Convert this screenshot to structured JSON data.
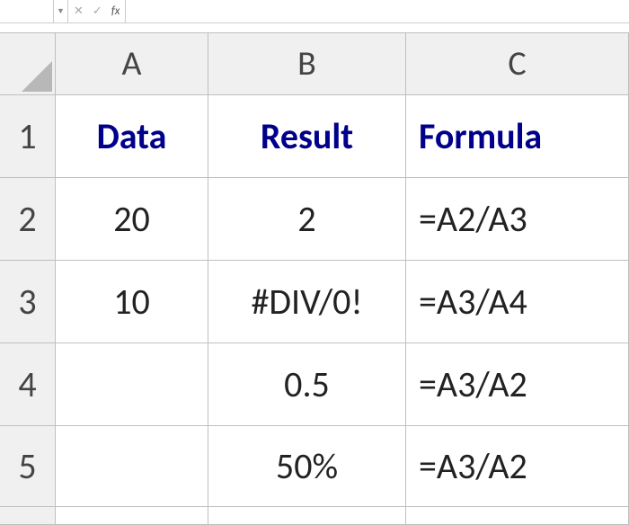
{
  "formula_bar": {
    "namebox": "",
    "cancel_label": "✕",
    "enter_label": "✓",
    "fx_label": "fx",
    "input": ""
  },
  "columns": [
    "A",
    "B",
    "C"
  ],
  "rows": [
    "1",
    "2",
    "3",
    "4",
    "5"
  ],
  "grid": {
    "r1": {
      "a": "Data",
      "b": "Result",
      "c": "Formula"
    },
    "r2": {
      "a": "20",
      "b": "2",
      "c": "=A2/A3"
    },
    "r3": {
      "a": "10",
      "b": "#DIV/0!",
      "c": "=A3/A4"
    },
    "r4": {
      "a": "",
      "b": "0.5",
      "c": "=A3/A2"
    },
    "r5": {
      "a": "",
      "b": "50%",
      "c": "=A3/A2"
    }
  }
}
